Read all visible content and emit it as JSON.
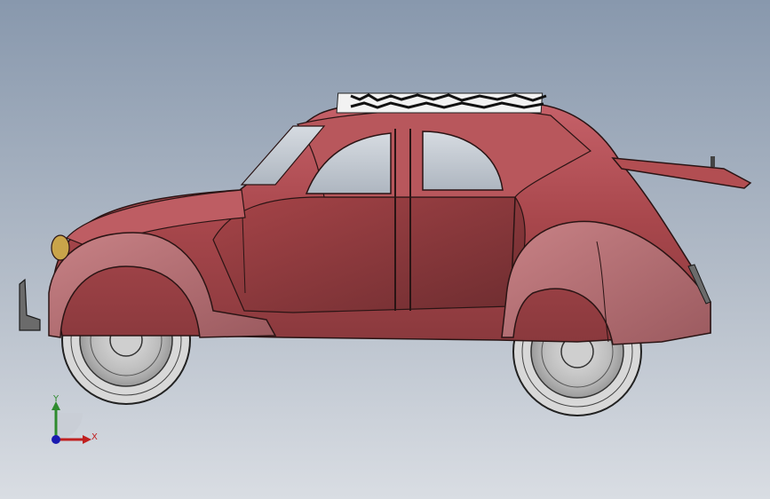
{
  "viewport": {
    "model": "car-side-view",
    "background_top": "#8898ad",
    "background_bottom": "#d9dde3",
    "body_color": "#b24e52",
    "body_dark_color": "#7c3235",
    "tire_color": "#e3e3e3",
    "glass_color": "#c6ccd4"
  },
  "triad": {
    "y_label": "Y",
    "x_label": "X",
    "y_color": "#2e8b2e",
    "x_color": "#c02020",
    "origin_color": "#1a1ab0"
  }
}
